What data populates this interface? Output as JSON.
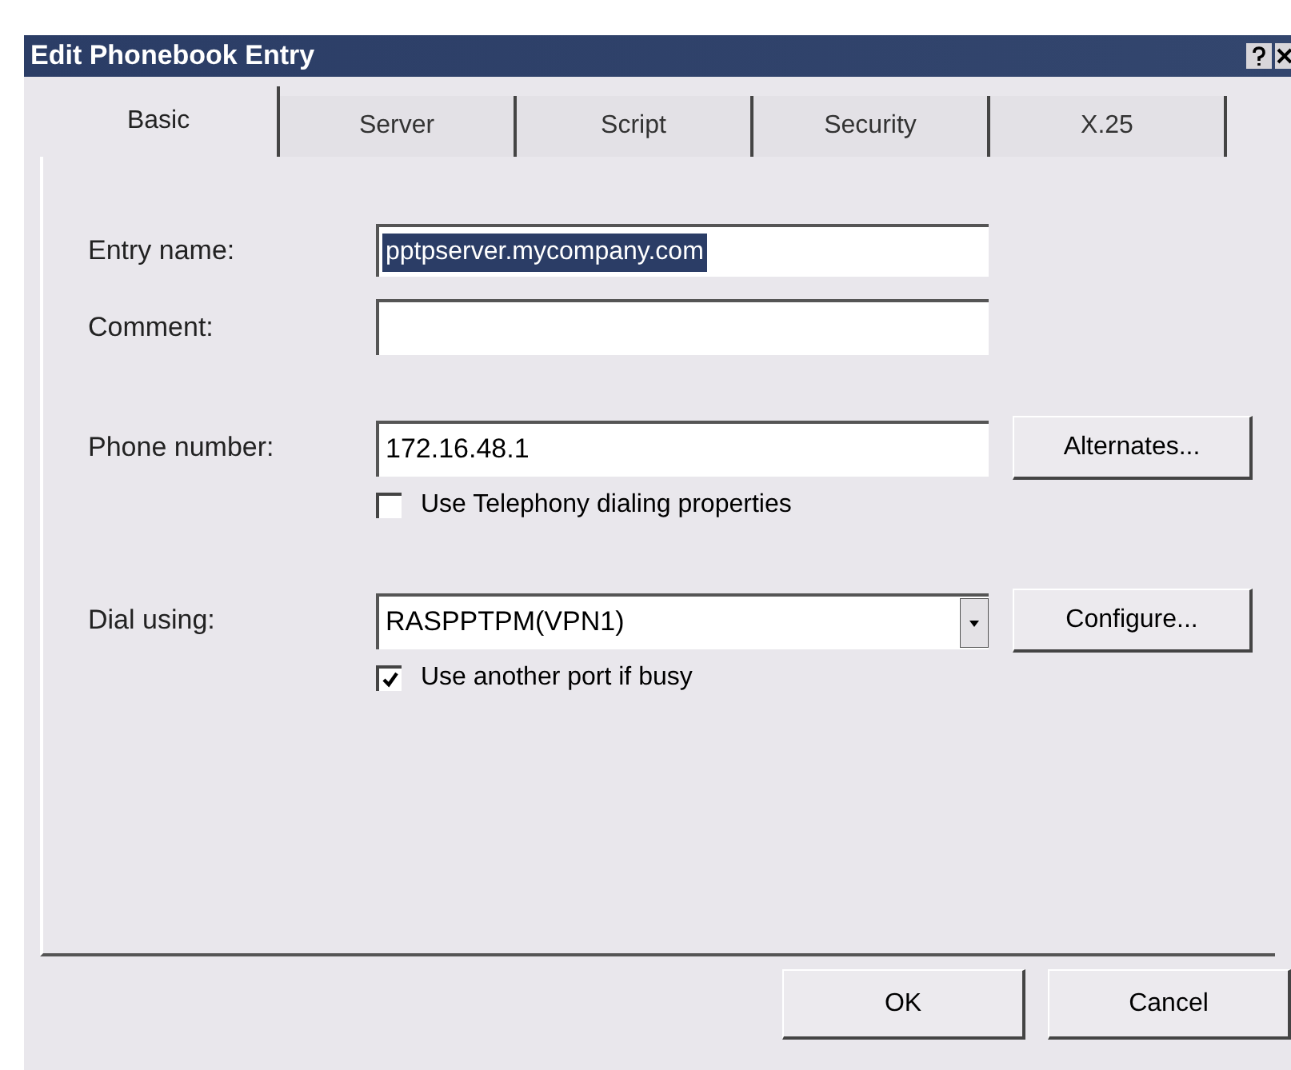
{
  "window": {
    "title": "Edit Phonebook Entry"
  },
  "tabs": [
    {
      "label": "Basic",
      "selected": true
    },
    {
      "label": "Server",
      "selected": false
    },
    {
      "label": "Script",
      "selected": false
    },
    {
      "label": "Security",
      "selected": false
    },
    {
      "label": "X.25",
      "selected": false
    }
  ],
  "entry_name": {
    "label": "Entry name:",
    "value": "pptpserver.mycompany.com",
    "selected": true
  },
  "comment": {
    "label": "Comment:"
  },
  "phone_number": {
    "label": "Phone number:",
    "value": "172.16.48.1",
    "button": "Alternates..."
  },
  "use_telephony": {
    "label": "Use Telephony dialing properties",
    "checked": false
  },
  "dial_using": {
    "label": "Dial using:",
    "value": "RASPPTPM(VPN1)",
    "button": "Configure..."
  },
  "use_another_port": {
    "label": "Use another port if busy",
    "checked": true
  },
  "buttons": [
    "OK",
    "Cancel"
  ]
}
